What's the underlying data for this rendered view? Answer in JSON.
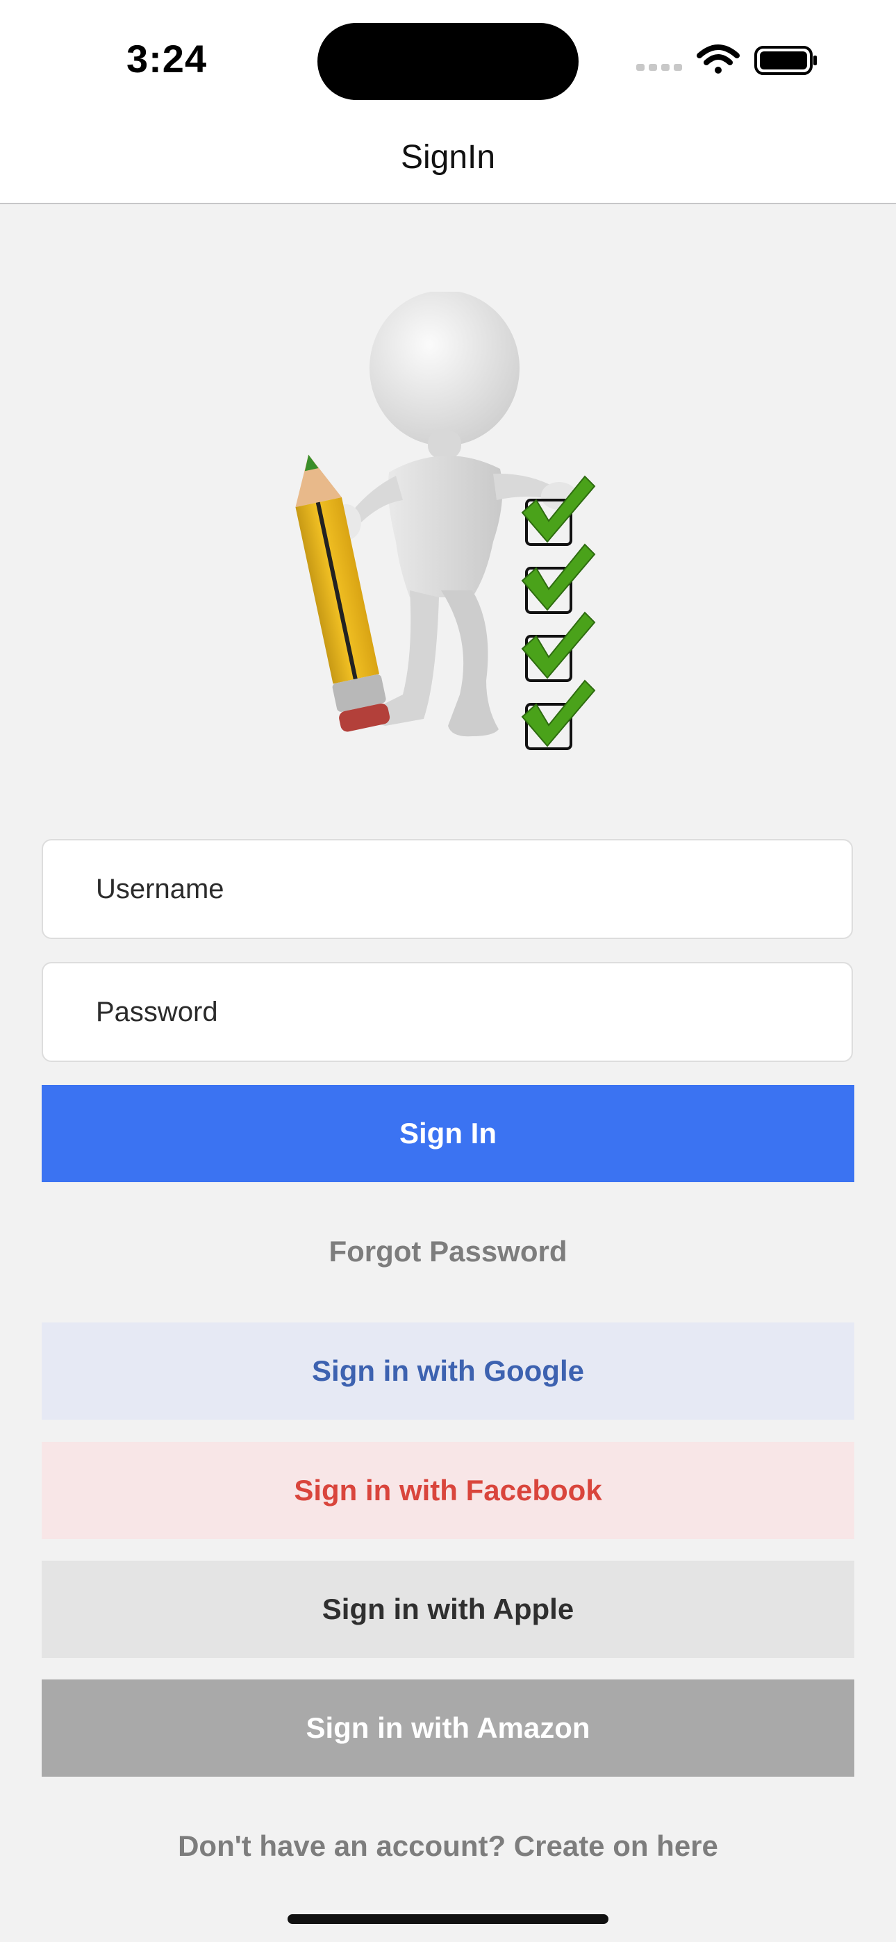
{
  "status_bar": {
    "time": "3:24",
    "icons": [
      "cellular-signal-icon",
      "wifi-icon",
      "battery-icon"
    ]
  },
  "nav": {
    "title": "SignIn"
  },
  "hero": {
    "image": "person-with-pencil-and-checklist-illustration"
  },
  "form": {
    "username_placeholder": "Username",
    "password_placeholder": "Password",
    "signin_label": "Sign In",
    "forgot_label": "Forgot Password"
  },
  "social": {
    "google_label": "Sign in with Google",
    "facebook_label": "Sign in with Facebook",
    "apple_label": "Sign in with Apple",
    "amazon_label": "Sign in with Amazon"
  },
  "footer": {
    "create_account_label": "Don't have an account? Create on here"
  },
  "colors": {
    "primary": "#3b73f2",
    "google_text": "#3d62b0",
    "facebook_text": "#d9453c",
    "amazon_bg": "#a9a9a9",
    "background": "#f2f2f2"
  }
}
